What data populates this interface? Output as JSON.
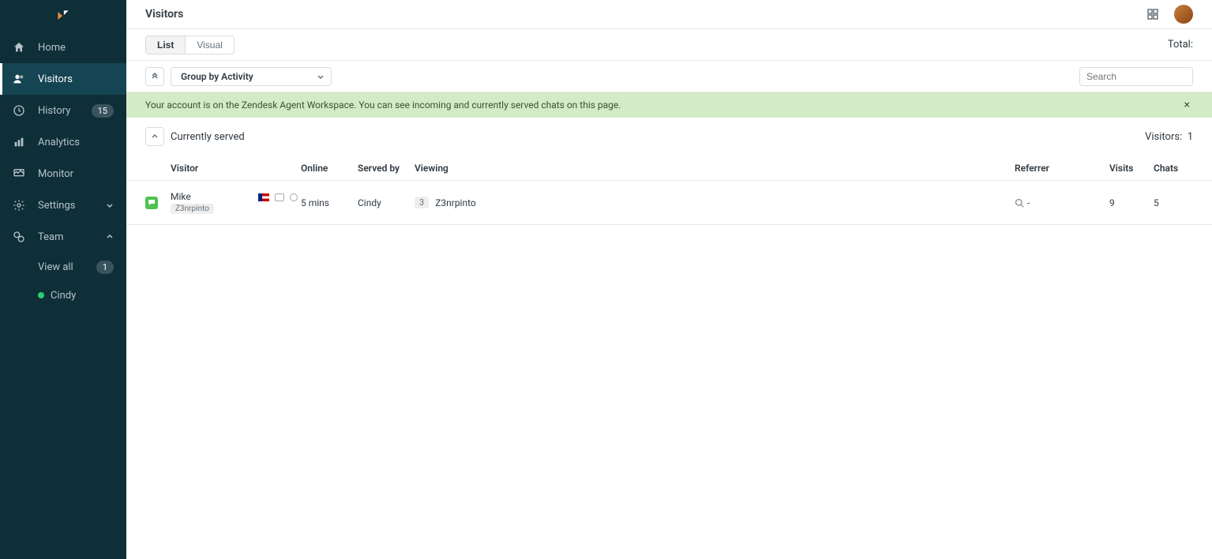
{
  "sidebar": {
    "items": {
      "home": {
        "label": "Home"
      },
      "visitors": {
        "label": "Visitors"
      },
      "history": {
        "label": "History",
        "badge": "15"
      },
      "analytics": {
        "label": "Analytics"
      },
      "monitor": {
        "label": "Monitor"
      },
      "settings": {
        "label": "Settings"
      },
      "team": {
        "label": "Team"
      }
    },
    "team_sub": {
      "view_all": {
        "label": "View all",
        "badge": "1"
      },
      "agent0": {
        "label": "Cindy"
      }
    }
  },
  "header": {
    "title": "Visitors"
  },
  "subheader": {
    "tabs": {
      "list": "List",
      "visual": "Visual"
    },
    "total_label": "Total:"
  },
  "toolbar": {
    "group_label": "Group by Activity",
    "search_placeholder": "Search"
  },
  "banner": {
    "text": "Your account is on the Zendesk Agent Workspace. You can see incoming and currently served chats on this page."
  },
  "section": {
    "title": "Currently served",
    "visitors_label": "Visitors:",
    "visitors_count": "1"
  },
  "columns": {
    "visitor": "Visitor",
    "online": "Online",
    "served_by": "Served by",
    "viewing": "Viewing",
    "referrer": "Referrer",
    "visits": "Visits",
    "chats": "Chats"
  },
  "rows": [
    {
      "name": "Mike",
      "accent": "Z3nrpinto",
      "online": "5 mins",
      "served_by": "Cindy",
      "viewing_count": "3",
      "viewing_page": "Z3nrpinto",
      "referrer": "-",
      "visits": "9",
      "chats": "5"
    }
  ]
}
